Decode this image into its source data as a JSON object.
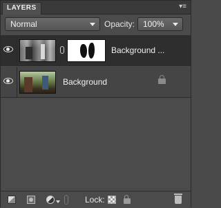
{
  "panel": {
    "title": "LAYERS",
    "menu_glyph": "▾≡"
  },
  "controls": {
    "blend_mode": "Normal",
    "opacity_label": "Opacity:",
    "opacity_value": "100%"
  },
  "layers": [
    {
      "name": "Background ...",
      "visible": true,
      "selected": true,
      "has_mask": true,
      "locked": false
    },
    {
      "name": "Background",
      "visible": true,
      "selected": false,
      "has_mask": false,
      "locked": true
    }
  ],
  "footer": {
    "lock_label": "Lock:",
    "icons": [
      "new-layer-icon",
      "layer-mask-icon",
      "adjustment-layer-icon",
      "link-layers-icon",
      "lock-transparency-icon",
      "lock-all-icon",
      "trash-icon"
    ]
  },
  "colors": {
    "panel_bg": "#4b4b4b",
    "selected_row": "#2e2e2e",
    "text": "#f0f0f0"
  }
}
